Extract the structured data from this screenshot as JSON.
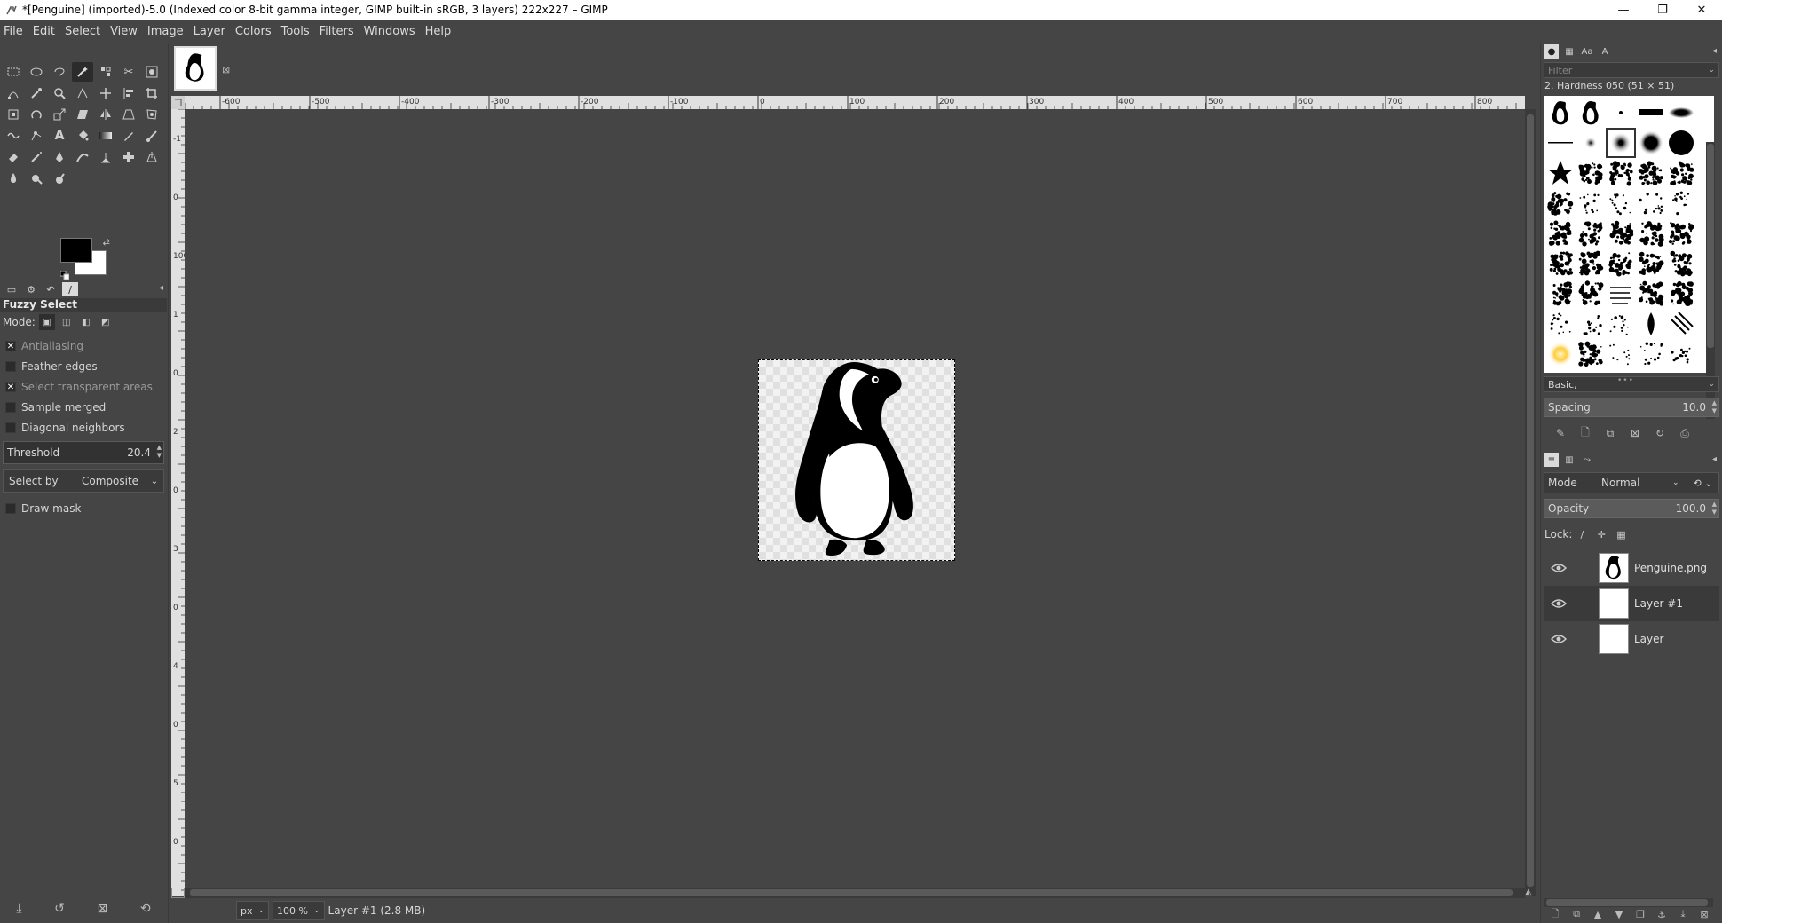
{
  "window": {
    "title": "*[Penguine] (imported)-5.0 (Indexed color 8-bit gamma integer, GIMP built-in sRGB, 3 layers) 222x227 – GIMP",
    "minimize_glyph": "—",
    "maximize_glyph": "❐",
    "close_glyph": "✕"
  },
  "menu": {
    "items": [
      "File",
      "Edit",
      "Select",
      "View",
      "Image",
      "Layer",
      "Colors",
      "Tools",
      "Filters",
      "Windows",
      "Help"
    ]
  },
  "toolbox": {
    "tools": [
      "rect-select",
      "ellipse-select",
      "free-select",
      "fuzzy-select",
      "select-by-color",
      "scissors-select",
      "foreground-select",
      "paths",
      "color-picker",
      "zoom",
      "measure",
      "move",
      "alignment",
      "crop",
      "unified-transform",
      "rotate",
      "scale",
      "shear",
      "flip",
      "perspective",
      "cage-transform",
      "warp-transform",
      "handle-transform",
      "text",
      "bucket-fill",
      "gradient",
      "pencil",
      "paintbrush",
      "eraser",
      "airbrush",
      "ink",
      "mypaint-brush",
      "clone",
      "heal",
      "perspective-clone",
      "blur-sharpen",
      "smudge",
      "dodge-burn"
    ],
    "active_tool": "fuzzy-select",
    "fg_color": "#000000",
    "bg_color": "#ffffff"
  },
  "tool_options": {
    "title": "Fuzzy Select",
    "mode_label": "Mode:",
    "options": [
      {
        "label": "Antialiasing",
        "checked": true,
        "dim": true
      },
      {
        "label": "Feather edges",
        "checked": false,
        "dim": false
      },
      {
        "label": "Select transparent areas",
        "checked": true,
        "dim": true
      },
      {
        "label": "Sample merged",
        "checked": false,
        "dim": false
      },
      {
        "label": "Diagonal neighbors",
        "checked": false,
        "dim": false
      }
    ],
    "threshold_label": "Threshold",
    "threshold_value": "20.4",
    "select_by_label": "Select by",
    "select_by_value": "Composite",
    "draw_mask_label": "Draw mask",
    "check_glyph": "✕"
  },
  "ruler": {
    "x_labels": [
      "-600",
      "-500",
      "-400",
      "-300",
      "-200",
      "-100",
      "0",
      "100",
      "200",
      "300",
      "400",
      "500",
      "600",
      "700",
      "800"
    ],
    "y_labels": [
      "-1",
      "0",
      "100",
      "1",
      "0",
      "2",
      "0",
      "3",
      "0",
      "4",
      "0",
      "5",
      "0"
    ]
  },
  "statusbar": {
    "unit": "px",
    "zoom": "100 %",
    "layer_info": "Layer #1 (2.8 MB)"
  },
  "brushes": {
    "filter_placeholder": "Filter",
    "selected_name": "2. Hardness 050 (51 × 51)",
    "tag": "Basic,",
    "spacing_label": "Spacing",
    "spacing_value": "10.0"
  },
  "layers": {
    "mode_label": "Mode",
    "mode_value": "Normal",
    "opacity_label": "Opacity",
    "opacity_value": "100.0",
    "lock_label": "Lock:",
    "items": [
      {
        "name": "Penguine.png",
        "selected": false
      },
      {
        "name": "Layer #1",
        "selected": true
      },
      {
        "name": "Layer",
        "selected": false
      }
    ]
  }
}
